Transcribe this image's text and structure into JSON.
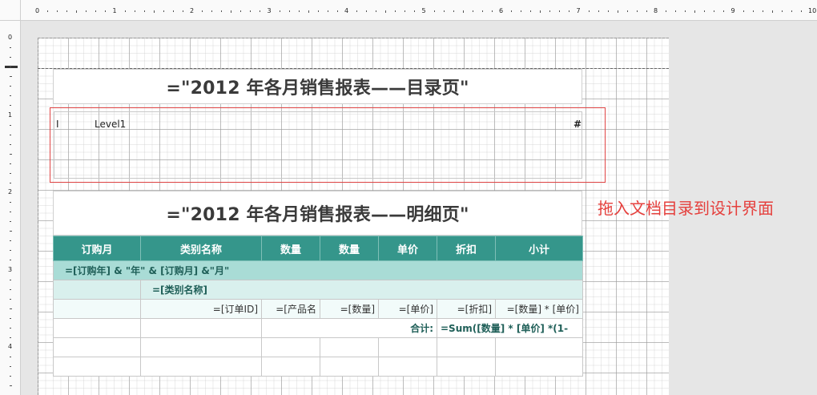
{
  "ruler": {
    "top_labels": [
      "0",
      "1",
      "2",
      "3",
      "4",
      "5",
      "6",
      "7",
      "8",
      "9",
      "10"
    ],
    "left_labels": [
      "0",
      "1",
      "2",
      "3",
      "4"
    ]
  },
  "report": {
    "toc_title": "=\"2012 年各月销售报表——目录页\"",
    "toc": {
      "prefix": "I",
      "level_label": "Level1",
      "page_marker": "#"
    },
    "detail_title": "=\"2012 年各月销售报表——明细页\"",
    "table": {
      "headers": [
        "订购月",
        "类别名称",
        "数量",
        "数量",
        "单价",
        "折扣",
        "小计"
      ],
      "group1_expr": "=[订购年] & \"年\"  & [订购月]  &\"月\"",
      "group2_expr": "=[类别名称]",
      "detail_cells": [
        "",
        "=[订单ID]",
        "=[产品名",
        "=[数量]",
        "=[单价]",
        "=[折扣]",
        "=[数量] * [单价]"
      ],
      "total_label": "合计:",
      "total_expr": "=Sum([数量] * [单价] *(1-"
    }
  },
  "annotation": {
    "text": "拖入文档目录到设计界面",
    "color": "#e5403d"
  },
  "colors": {
    "header_bg": "#35968b",
    "group1_bg": "#a9dcd6",
    "group2_bg": "#d9f0ed",
    "toc_border": "#e04545"
  }
}
